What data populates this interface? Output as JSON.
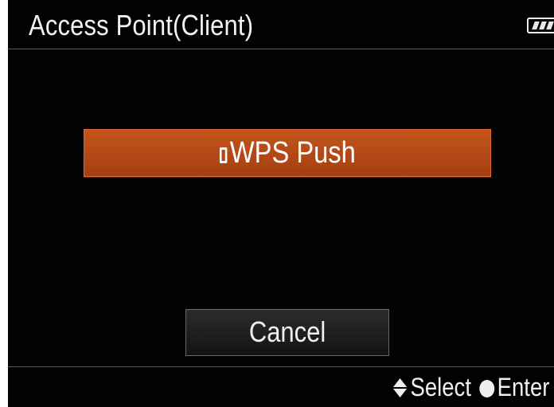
{
  "header": {
    "title": "Access Point(Client)",
    "battery_icon": "battery-icon"
  },
  "menu": {
    "wps_button_label": "WPS Push",
    "wps_icon": "phone-icon",
    "cancel_label": "Cancel"
  },
  "footer": {
    "select_icon": "up-down-arrow-icon",
    "select_label": "Select",
    "enter_icon": "center-button-icon",
    "enter_label": "Enter"
  },
  "colors": {
    "background": "#020202",
    "accent": "#b84a17",
    "text": "#f2f2f2"
  }
}
